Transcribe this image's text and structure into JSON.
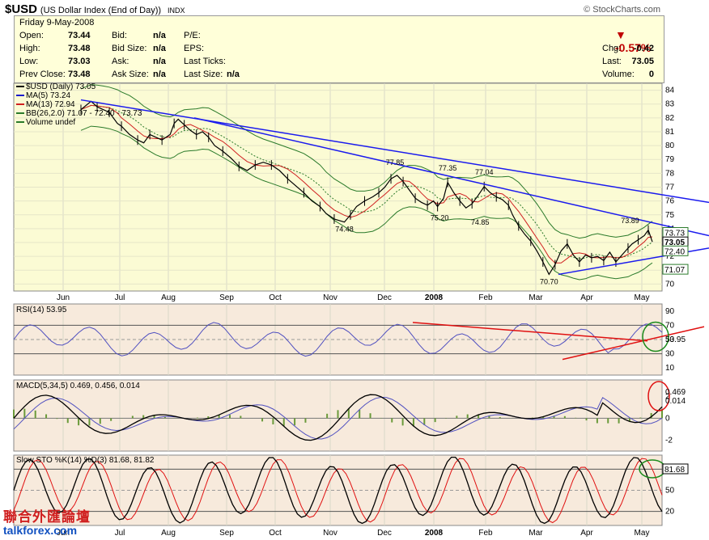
{
  "header": {
    "symbol": "$USD",
    "name": "(US Dollar Index (End of Day))",
    "exchange": "INDX",
    "brand": "© StockCharts.com"
  },
  "quote": {
    "date": "Friday   9-May-2008",
    "open_l": "Open:",
    "open": "73.44",
    "high_l": "High:",
    "high": "73.48",
    "low_l": "Low:",
    "low": "73.03",
    "prev_l": "Prev Close:",
    "prev": "73.48",
    "bid_l": "Bid:",
    "bid": "n/a",
    "bidsize_l": "Bid Size:",
    "bidsize": "n/a",
    "ask_l": "Ask:",
    "ask": "n/a",
    "asksize_l": "Ask Size:",
    "asksize": "n/a",
    "pe_l": "P/E:",
    "eps_l": "EPS:",
    "lastticks_l": "Last Ticks:",
    "lastsize_l": "Last Size:",
    "lastsize": "n/a",
    "pct": "-0.57%",
    "chg_l": "Chg:",
    "chg": "-0.42",
    "last_l": "Last:",
    "last": "73.05",
    "vol_l": "Volume:",
    "vol": "0"
  },
  "colors": {
    "price_bg": "#fbfbd4",
    "lower_bg": "#f7eadc",
    "ma5": "#1a1acc",
    "ma13": "#d02020",
    "bb": "#2a7a2a",
    "trend": "#1a1aee",
    "annot_red": "#e01010",
    "circle_green": "#1a8a1a"
  },
  "chart_data": {
    "type": "line",
    "x_labels": [
      "Jun",
      "Jul",
      "Aug",
      "Sep",
      "Oct",
      "Nov",
      "Dec",
      "2008",
      "Feb",
      "Mar",
      "Apr",
      "May"
    ],
    "price": {
      "legend": [
        "$USD (Daily) 73.05",
        "MA(5) 73.24",
        "MA(13) 72.94",
        "BB(26,2.0) 71.07 - 72.40 - 73.73",
        "Volume undef"
      ],
      "ylim": [
        69.5,
        84.5
      ],
      "yticks": [
        84,
        83,
        82,
        81,
        80,
        79,
        78,
        77,
        76,
        75,
        74,
        73,
        72,
        71,
        70
      ],
      "close_points": [
        [
          0,
          82.6
        ],
        [
          0.05,
          83.2
        ],
        [
          0.08,
          82.8
        ],
        [
          0.11,
          82.6
        ],
        [
          0.14,
          82.4
        ],
        [
          0.18,
          81.6
        ],
        [
          0.2,
          81.4
        ],
        [
          0.24,
          80.8
        ],
        [
          0.28,
          80.4
        ],
        [
          0.31,
          80.2
        ],
        [
          0.34,
          80.8
        ],
        [
          0.37,
          80.6
        ],
        [
          0.4,
          80.4
        ],
        [
          0.44,
          80.8
        ],
        [
          0.46,
          81.6
        ],
        [
          0.48,
          81.9
        ],
        [
          0.51,
          81.5
        ],
        [
          0.54,
          81.1
        ],
        [
          0.57,
          80.8
        ],
        [
          0.6,
          81.0
        ],
        [
          0.63,
          80.6
        ],
        [
          0.66,
          80.0
        ],
        [
          0.7,
          79.6
        ],
        [
          0.74,
          79.1
        ],
        [
          0.78,
          78.5
        ],
        [
          0.82,
          78.2
        ],
        [
          0.86,
          78.6
        ],
        [
          0.9,
          78.8
        ],
        [
          0.94,
          78.6
        ],
        [
          0.98,
          78.2
        ],
        [
          1.02,
          77.6
        ],
        [
          1.06,
          77.1
        ],
        [
          1.1,
          76.6
        ],
        [
          1.14,
          76.0
        ],
        [
          1.18,
          75.6
        ],
        [
          1.21,
          75.1
        ],
        [
          1.25,
          74.7
        ],
        [
          1.3,
          74.48
        ],
        [
          1.33,
          75.0
        ],
        [
          1.36,
          75.6
        ],
        [
          1.4,
          76.0
        ],
        [
          1.44,
          76.3
        ],
        [
          1.47,
          76.6
        ],
        [
          1.5,
          77.0
        ],
        [
          1.53,
          77.6
        ],
        [
          1.56,
          77.85
        ],
        [
          1.59,
          77.4
        ],
        [
          1.62,
          76.8
        ],
        [
          1.65,
          76.2
        ],
        [
          1.68,
          75.9
        ],
        [
          1.71,
          75.7
        ],
        [
          1.74,
          76.0
        ],
        [
          1.76,
          75.6
        ],
        [
          1.79,
          76.2
        ],
        [
          1.81,
          77.35
        ],
        [
          1.84,
          76.6
        ],
        [
          1.87,
          76.0
        ],
        [
          1.9,
          75.5
        ],
        [
          1.93,
          75.8
        ],
        [
          1.96,
          76.4
        ],
        [
          1.99,
          77.04
        ],
        [
          2.02,
          76.6
        ],
        [
          2.05,
          76.3
        ],
        [
          2.08,
          76.1
        ],
        [
          2.11,
          75.7
        ],
        [
          2.13,
          75.0
        ],
        [
          2.16,
          74.2
        ],
        [
          2.19,
          73.6
        ],
        [
          2.22,
          73.1
        ],
        [
          2.25,
          72.4
        ],
        [
          2.28,
          71.6
        ],
        [
          2.31,
          70.7
        ],
        [
          2.34,
          71.4
        ],
        [
          2.37,
          72.4
        ],
        [
          2.4,
          72.9
        ],
        [
          2.43,
          72.1
        ],
        [
          2.46,
          71.6
        ],
        [
          2.49,
          72.1
        ],
        [
          2.52,
          71.9
        ],
        [
          2.55,
          72.0
        ],
        [
          2.58,
          71.7
        ],
        [
          2.61,
          72.3
        ],
        [
          2.64,
          71.6
        ],
        [
          2.67,
          72.1
        ],
        [
          2.7,
          72.6
        ],
        [
          2.72,
          72.9
        ],
        [
          2.75,
          73.2
        ],
        [
          2.78,
          73.5
        ],
        [
          2.8,
          73.9
        ],
        [
          2.82,
          73.05
        ]
      ],
      "labels": [
        {
          "text": "77.85",
          "x": 1.55,
          "y": 78.6
        },
        {
          "text": "77.35",
          "x": 1.81,
          "y": 78.2
        },
        {
          "text": "77.04",
          "x": 1.99,
          "y": 77.9
        },
        {
          "text": "74.48",
          "x": 1.3,
          "y": 73.8
        },
        {
          "text": "75.20",
          "x": 1.77,
          "y": 74.6
        },
        {
          "text": "74.85",
          "x": 1.97,
          "y": 74.3
        },
        {
          "text": "70.70",
          "x": 2.31,
          "y": 70.0
        },
        {
          "text": "73.89",
          "x": 2.71,
          "y": 74.4
        }
      ],
      "price_tags": [
        {
          "text": "73.73",
          "y": 73.73,
          "color": "#2a7a2a"
        },
        {
          "text": "73.05",
          "y": 73.05,
          "color": "#000000"
        },
        {
          "text": "72.40",
          "y": 72.4,
          "color": "#2a7a2a"
        },
        {
          "text": "71.07",
          "y": 71.07,
          "color": "#2a7a2a"
        }
      ]
    },
    "rsi": {
      "legend": "RSI(14) 53.95",
      "ylim": [
        0,
        100
      ],
      "yticks": [
        90,
        70,
        50,
        30,
        10
      ],
      "value": "53.95"
    },
    "macd": {
      "legend": "MACD(5,34,5) 0.469, 0.456, 0.014",
      "ylim": [
        -3,
        3.5
      ],
      "yticks": [
        2,
        0,
        -2
      ],
      "tag1": "0.469",
      "tag2": "0.014"
    },
    "sto": {
      "legend": "Slow STO %K(14) %D(3) 81.68, 81.82",
      "ylim": [
        0,
        100
      ],
      "yticks": [
        80,
        50,
        20
      ],
      "value": "81.68"
    }
  },
  "watermark": {
    "cn": "聯合外匯論壇",
    "en": "talkforex.com"
  }
}
